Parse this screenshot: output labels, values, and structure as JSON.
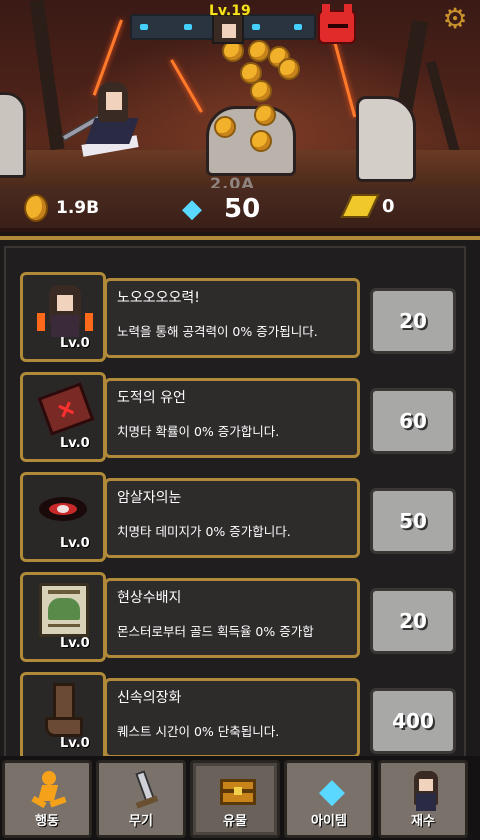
{
  "hud": {
    "level": "Lv.19",
    "timer": "2.0A",
    "settings_icon": "gear-icon"
  },
  "resources": {
    "gold": "1.9B",
    "gems": "50",
    "tickets": "0"
  },
  "items": [
    {
      "name": "노오오오오력!",
      "desc": "노력을 통해 공격력이 0% 증가됩니다.",
      "level": "Lv.0",
      "price": "20",
      "icon": "angry-girl-icon"
    },
    {
      "name": "도적의 유언",
      "desc": "치명타 확률이 0% 증가합니다.",
      "level": "Lv.0",
      "price": "60",
      "icon": "red-book-icon"
    },
    {
      "name": "암살자의눈",
      "desc": "치명타 데미지가 0% 증가합니다.",
      "level": "Lv.0",
      "price": "50",
      "icon": "assassin-eye-icon"
    },
    {
      "name": "현상수배지",
      "desc": "몬스터로부터 골드 획득율 0% 증가합",
      "level": "Lv.0",
      "price": "20",
      "icon": "wanted-poster-icon"
    },
    {
      "name": "신속의장화",
      "desc": "퀘스트 시간이 0% 단축됩니다.",
      "level": "Lv.0",
      "price": "400",
      "icon": "boot-icon"
    }
  ],
  "nav": [
    {
      "label": "행동",
      "icon": "running-man-icon"
    },
    {
      "label": "무기",
      "icon": "sword-icon"
    },
    {
      "label": "유물",
      "icon": "treasure-chest-icon"
    },
    {
      "label": "아이템",
      "icon": "diamond-icon"
    },
    {
      "label": "재수",
      "icon": "character-icon"
    }
  ],
  "colors": {
    "frame_gold": "#b08a38",
    "price_button": "#a8a8a6",
    "level_yellow": "#f7e21b",
    "gem_blue": "#5ad8ff"
  }
}
